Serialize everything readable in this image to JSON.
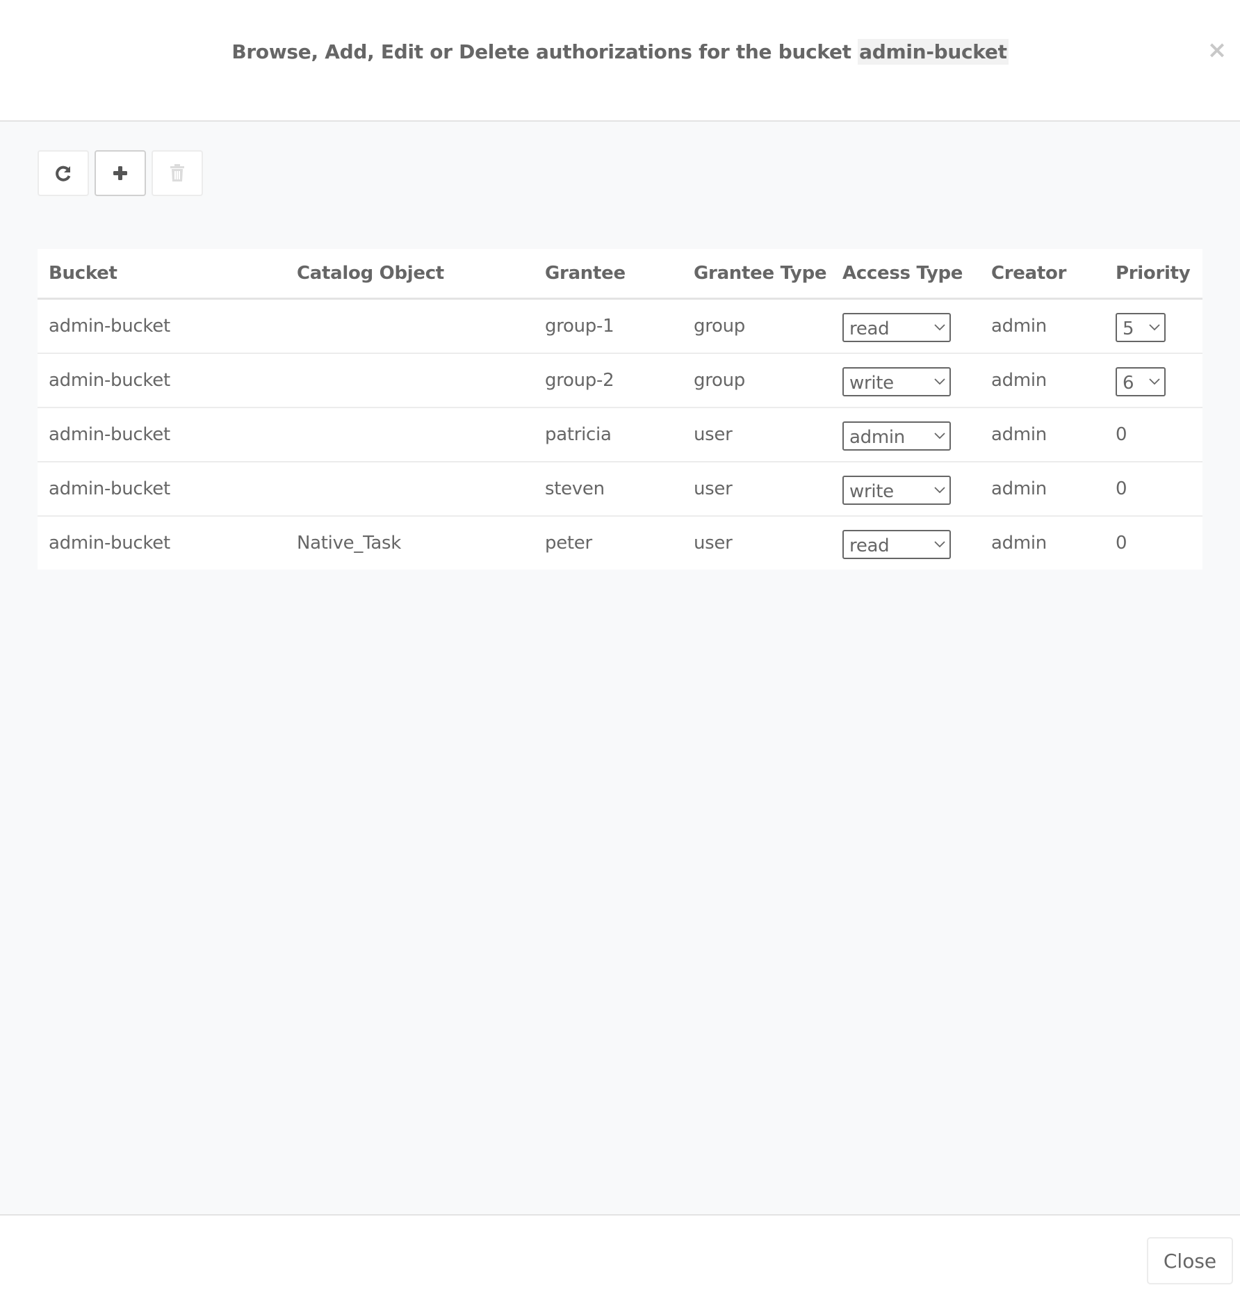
{
  "header": {
    "title_prefix": "Browse, Add, Edit or Delete authorizations for the bucket ",
    "bucket_name": "admin-bucket",
    "close_icon": "close-icon"
  },
  "toolbar": {
    "buttons": [
      {
        "name": "refresh",
        "icon": "refresh-icon",
        "enabled": true
      },
      {
        "name": "add",
        "icon": "plus-icon",
        "enabled": true
      },
      {
        "name": "delete",
        "icon": "trash-icon",
        "enabled": false
      }
    ]
  },
  "table": {
    "columns": [
      "Bucket",
      "Catalog Object",
      "Grantee",
      "Grantee Type",
      "Access Type",
      "Creator",
      "Priority"
    ],
    "rows": [
      {
        "bucket": "admin-bucket",
        "catalog_object": "",
        "grantee": "group-1",
        "grantee_type": "group",
        "access_type": "read",
        "creator": "admin",
        "priority": "5",
        "priority_editable": true
      },
      {
        "bucket": "admin-bucket",
        "catalog_object": "",
        "grantee": "group-2",
        "grantee_type": "group",
        "access_type": "write",
        "creator": "admin",
        "priority": "6",
        "priority_editable": true
      },
      {
        "bucket": "admin-bucket",
        "catalog_object": "",
        "grantee": "patricia",
        "grantee_type": "user",
        "access_type": "admin",
        "creator": "admin",
        "priority": "0",
        "priority_editable": false
      },
      {
        "bucket": "admin-bucket",
        "catalog_object": "",
        "grantee": "steven",
        "grantee_type": "user",
        "access_type": "write",
        "creator": "admin",
        "priority": "0",
        "priority_editable": false
      },
      {
        "bucket": "admin-bucket",
        "catalog_object": "Native_Task",
        "grantee": "peter",
        "grantee_type": "user",
        "access_type": "read",
        "creator": "admin",
        "priority": "0",
        "priority_editable": false
      }
    ]
  },
  "footer": {
    "close_label": "Close"
  },
  "colors": {
    "text": "#666666",
    "body_bg": "#f8f9fa",
    "border": "#e3e3e3",
    "close_x": "#c8c8c8",
    "disabled_icon": "#dcdcdc"
  }
}
